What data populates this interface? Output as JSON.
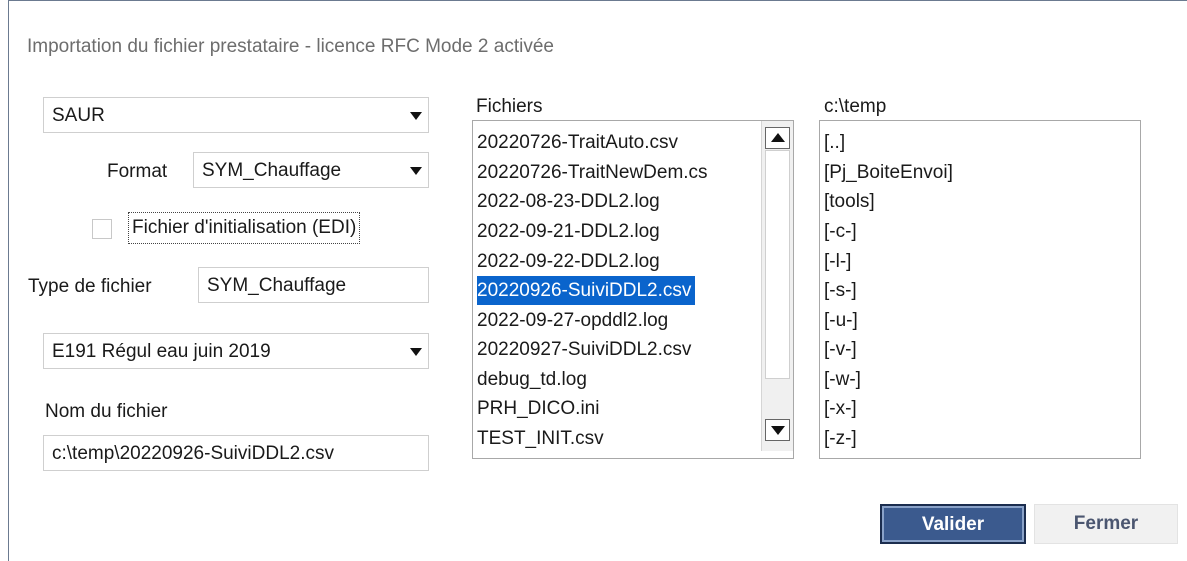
{
  "window": {
    "title": "Importation du fichier prestataire - licence RFC Mode 2 activée"
  },
  "left": {
    "provider_select": {
      "value": "SAUR"
    },
    "format": {
      "label": "Format",
      "value": "SYM_Chauffage"
    },
    "init_checkbox": {
      "label": "Fichier d'initialisation (EDI)",
      "checked": false
    },
    "file_type": {
      "label": "Type de fichier",
      "value": "SYM_Chauffage"
    },
    "period_select": {
      "value": "E191  Régul eau juin 2019"
    },
    "filename": {
      "label": "Nom du fichier",
      "value": "c:\\temp\\20220926-SuiviDDL2.csv"
    }
  },
  "files": {
    "label": "Fichiers",
    "items": [
      "20220726-TraitAuto.csv",
      "20220726-TraitNewDem.cs",
      "2022-08-23-DDL2.log",
      "2022-09-21-DDL2.log",
      "2022-09-22-DDL2.log",
      "20220926-SuiviDDL2.csv",
      "2022-09-27-opddl2.log",
      "20220927-SuiviDDL2.csv",
      "debug_td.log",
      "PRH_DICO.ini",
      "TEST_INIT.csv"
    ],
    "selected_index": 5
  },
  "directories": {
    "label": "c:\\temp",
    "items": [
      "[..]",
      "[Pj_BoiteEnvoi]",
      "[tools]",
      "[-c-]",
      "[-l-]",
      "[-s-]",
      "[-u-]",
      "[-v-]",
      "[-w-]",
      "[-x-]",
      "[-z-]"
    ]
  },
  "buttons": {
    "validate": "Valider",
    "close": "Fermer"
  },
  "colors": {
    "selection": "#0a64cc",
    "primary_button": "#3b5a8e"
  }
}
